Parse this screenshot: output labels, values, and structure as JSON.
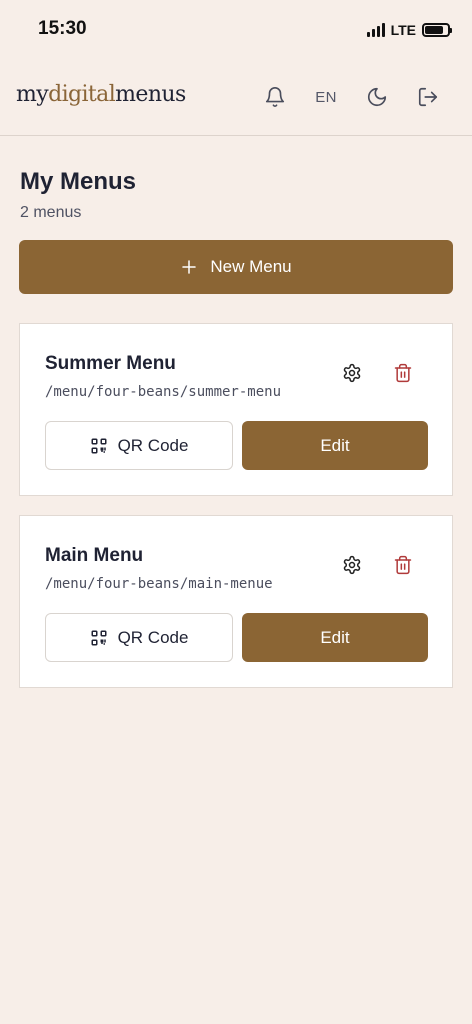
{
  "status_bar": {
    "time": "15:30",
    "network": "LTE"
  },
  "header": {
    "logo": {
      "part1": "my",
      "part2": "digital",
      "part3": "menus"
    },
    "language": "EN",
    "icons": [
      "bell-icon",
      "moon-icon",
      "logout-icon"
    ]
  },
  "page": {
    "title": "My Menus",
    "count": "2 menus",
    "new_menu_label": "New Menu"
  },
  "menus": [
    {
      "name": "Summer Menu",
      "path": "/menu/four-beans/summer-menu",
      "qr_label": "QR Code",
      "edit_label": "Edit"
    },
    {
      "name": "Main Menu",
      "path": "/menu/four-beans/main-menue",
      "qr_label": "QR Code",
      "edit_label": "Edit"
    }
  ],
  "colors": {
    "background": "#f7eee8",
    "accent": "#8b6534",
    "delete": "#b03a3a",
    "text": "#1f2233"
  }
}
